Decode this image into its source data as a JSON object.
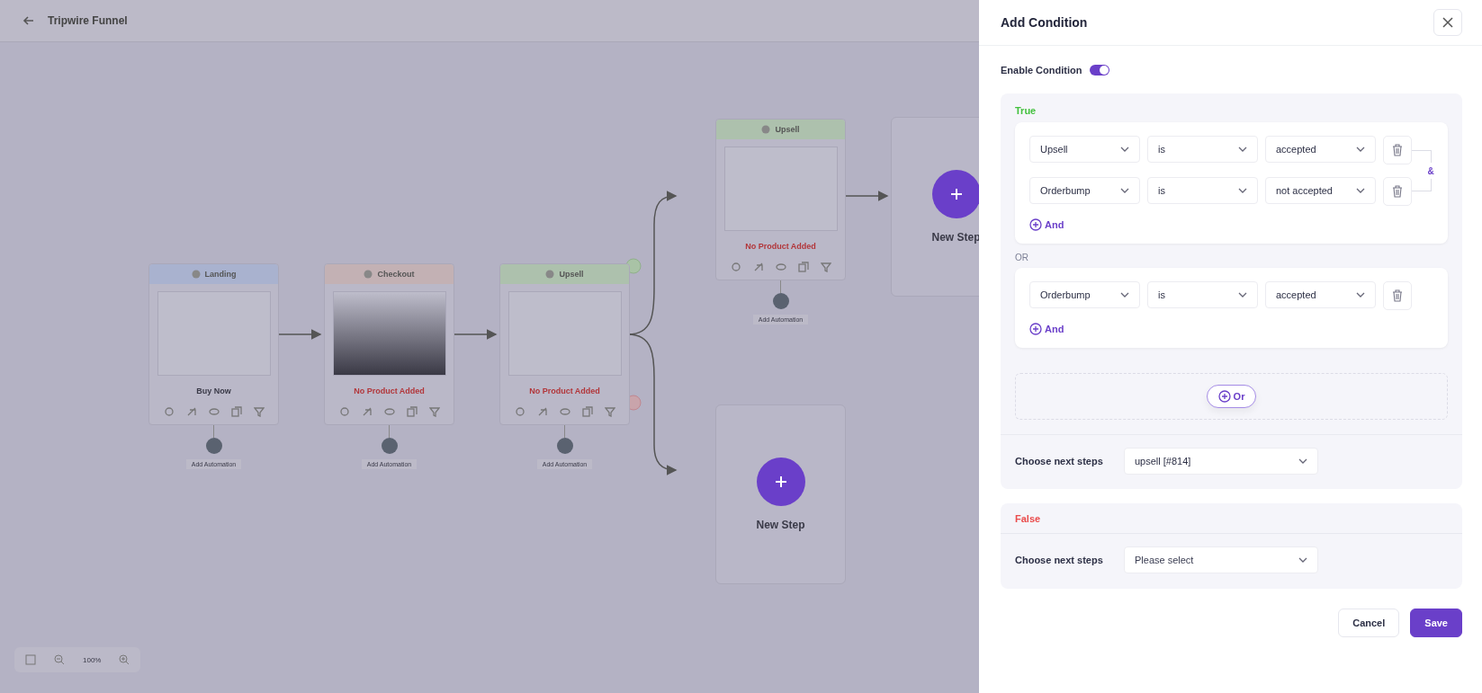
{
  "canvas": {
    "title": "Tripwire Funnel",
    "steps": [
      {
        "kind": "page",
        "title": "Landing",
        "color": "#a9b2cf",
        "note": "Buy Now",
        "product_missing": false,
        "automation": "Add Automation"
      },
      {
        "kind": "page",
        "title": "Checkout",
        "color": "#c3b1b4",
        "note": "No Product Added",
        "product_missing": true,
        "automation": "Add Automation"
      },
      {
        "kind": "page",
        "title": "Upsell",
        "color": "#adc1ad",
        "note": "No Product Added",
        "product_missing": true,
        "automation": "Add Automation"
      },
      {
        "kind": "page",
        "title": "Upsell",
        "color": "#adc1ad",
        "note": "No Product Added",
        "product_missing": true,
        "automation": "Add Automation"
      },
      {
        "kind": "new",
        "title": "New Step"
      },
      {
        "kind": "new",
        "title": "New Step"
      }
    ],
    "zoom": "100%"
  },
  "panel": {
    "title": "Add Condition",
    "enable": {
      "label": "Enable Condition",
      "on": true
    },
    "true_branch": {
      "heading": "True",
      "groups": [
        {
          "rules": [
            {
              "field": "Upsell",
              "operator": "is",
              "value": "accepted"
            },
            {
              "field": "Orderbump",
              "operator": "is",
              "value": "not accepted"
            }
          ],
          "joiner": "&",
          "add_label": "And"
        },
        {
          "separator": "OR",
          "rules": [
            {
              "field": "Orderbump",
              "operator": "is",
              "value": "accepted"
            }
          ],
          "add_label": "And"
        }
      ],
      "add_group_label": "Or",
      "next_label": "Choose next steps",
      "next_value": "upsell [#814]"
    },
    "false_branch": {
      "heading": "False",
      "next_label": "Choose next steps",
      "next_placeholder": "Please select"
    },
    "buttons": [
      {
        "label": "Cancel",
        "kind": "secondary"
      },
      {
        "label": "Save",
        "kind": "primary"
      }
    ]
  }
}
